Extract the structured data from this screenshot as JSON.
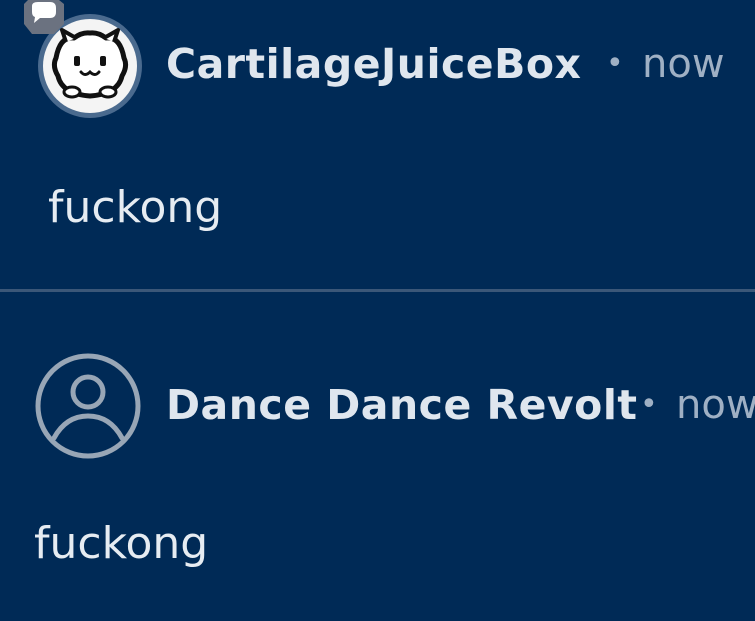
{
  "comments": [
    {
      "username": "CartilageJuiceBox",
      "separator": "•",
      "time": "now",
      "body": "fuckong",
      "avatar_icon": "cat-face-icon",
      "badge_icon": "speech-bubble-icon"
    },
    {
      "username": "Dance Dance Revolt",
      "separator": "•",
      "time": "now",
      "body": "fuckong",
      "avatar_icon": "default-user-icon"
    }
  ],
  "colors": {
    "background": "#002a56",
    "username": "#dfe6ee",
    "meta": "#9fb0c4",
    "divider": "#3b5778"
  }
}
